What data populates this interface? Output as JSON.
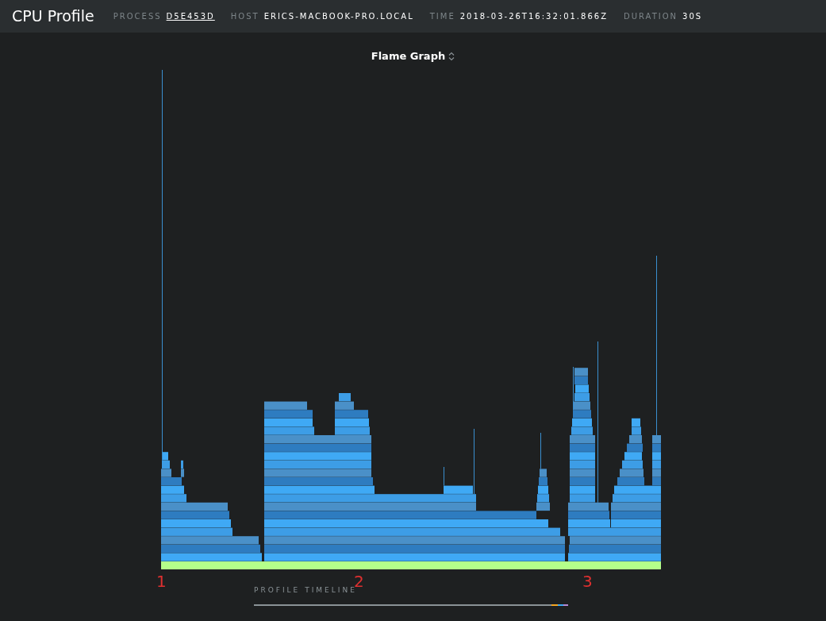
{
  "header": {
    "title": "CPU Profile",
    "meta": [
      {
        "label": "PROCESS",
        "value": "D5E453D",
        "link": true
      },
      {
        "label": "HOST",
        "value": "ERICS-MACBOOK-PRO.LOCAL",
        "link": false
      },
      {
        "label": "TIME",
        "value": "2018-03-26T16:32:01.866Z",
        "link": false
      },
      {
        "label": "DURATION",
        "value": "30S",
        "link": false
      }
    ]
  },
  "view_selector": {
    "label": "Flame Graph"
  },
  "annotations": [
    "1",
    "2",
    "3"
  ],
  "timeline": {
    "label": "PROFILE TIMELINE"
  }
}
